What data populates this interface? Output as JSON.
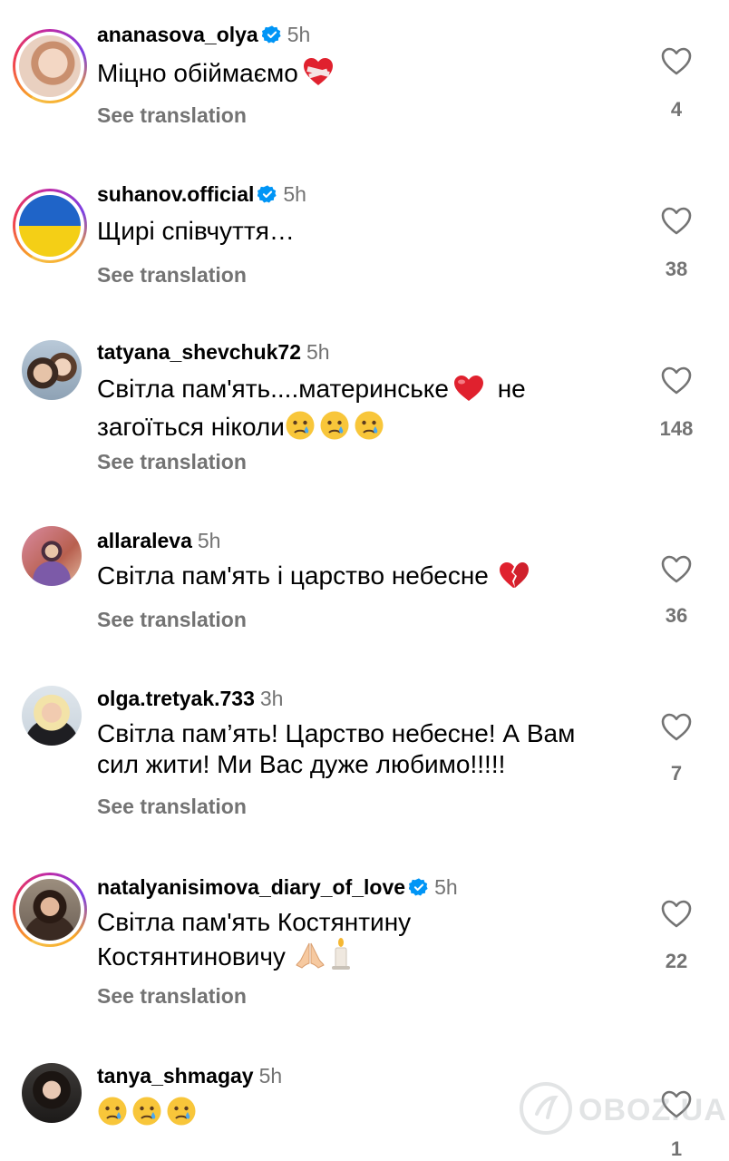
{
  "comments": [
    {
      "username": "ananasova_olya",
      "verified": true,
      "time": "5h",
      "text": "Міцно обіймаємо",
      "emoji": "mending-heart",
      "see_translation": "See translation",
      "likes": "4",
      "avatar_ring": true
    },
    {
      "username": "suhanov.official",
      "verified": true,
      "time": "5h",
      "text": "Щирі співчуття…",
      "see_translation": "See translation",
      "likes": "38",
      "avatar_ring": true
    },
    {
      "username": "tatyana_shevchuk72",
      "verified": false,
      "time": "5h",
      "text_line1": "Світла пам'ять....материнське",
      "text_line1_after": "не",
      "text_line2": "загоїться ніколи",
      "see_translation": "See translation",
      "likes": "148",
      "avatar_ring": false
    },
    {
      "username": "allaraleva",
      "verified": false,
      "time": "5h",
      "text": "Світла пам'ять і царство небесне",
      "emoji": "broken-heart",
      "see_translation": "See translation",
      "likes": "36",
      "avatar_ring": false
    },
    {
      "username": "olga.tretyak.733",
      "verified": false,
      "time": "3h",
      "text_line1": "Світла пам’ять! Царство небесне! А Вам",
      "text_line2": "сил жити! Ми Вас дуже любимо!!!!!",
      "see_translation": "See translation",
      "likes": "7",
      "avatar_ring": false
    },
    {
      "username": "natalyanisimova_diary_of_love",
      "verified": true,
      "time": "5h",
      "text_line1": "Світла пам'ять Костянтину",
      "text_line2": "Костянтиновичу",
      "see_translation": "See translation",
      "likes": "22",
      "avatar_ring": true
    },
    {
      "username": "tanya_shmagay",
      "verified": false,
      "time": "5h",
      "text": "",
      "see_translation": "",
      "likes": "1",
      "avatar_ring": false
    }
  ],
  "watermark": "OBOZ.UA",
  "colors": {
    "secondary_text": "#737373",
    "verified_blue": "#0095f6",
    "heart_red": "#e0212e"
  }
}
